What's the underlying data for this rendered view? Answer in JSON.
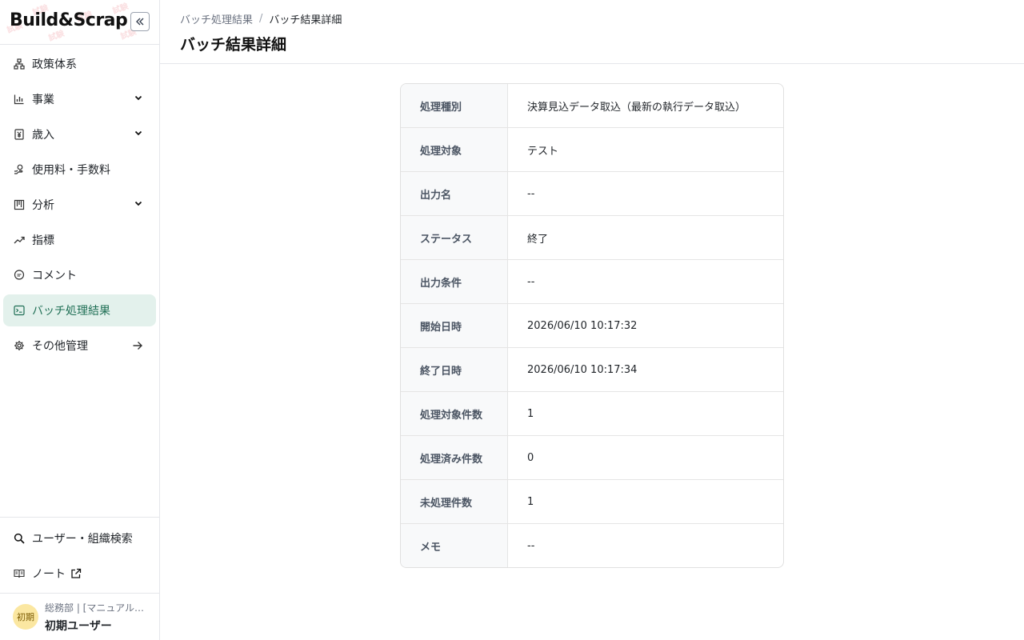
{
  "brand": {
    "logo_text": "Build&Scrap",
    "stamp_text": "試験"
  },
  "sidebar": {
    "items": [
      {
        "label": "政策体系",
        "icon": "hierarchy-icon",
        "has_chevron": false
      },
      {
        "label": "事業",
        "icon": "bar-chart-icon",
        "has_chevron": true
      },
      {
        "label": "歳入",
        "icon": "yen-box-icon",
        "has_chevron": true
      },
      {
        "label": "使用料・手数料",
        "icon": "coin-hand-icon",
        "has_chevron": false
      },
      {
        "label": "分析",
        "icon": "board-icon",
        "has_chevron": true
      },
      {
        "label": "指標",
        "icon": "trend-icon",
        "has_chevron": false
      },
      {
        "label": "コメント",
        "icon": "comment-icon",
        "has_chevron": false
      },
      {
        "label": "バッチ処理結果",
        "icon": "terminal-icon",
        "has_chevron": false,
        "active": true
      },
      {
        "label": "その他管理",
        "icon": "gear-icon",
        "has_arrow": true
      }
    ],
    "bottom": [
      {
        "label": "ユーザー・組織検索",
        "icon": "search-icon"
      },
      {
        "label": "ノート",
        "icon": "book-icon",
        "external": true
      }
    ],
    "user": {
      "avatar": "初期",
      "dept": "総務部 | [マニュアル…",
      "name": "初期ユーザー"
    }
  },
  "header": {
    "breadcrumb": {
      "parent": "バッチ処理結果",
      "separator": "/",
      "current": "バッチ結果詳細"
    },
    "title": "バッチ結果詳細"
  },
  "detail": {
    "rows": [
      {
        "label": "処理種別",
        "value": "決算見込データ取込（最新の執行データ取込）"
      },
      {
        "label": "処理対象",
        "value": "テスト"
      },
      {
        "label": "出力名",
        "value": "--"
      },
      {
        "label": "ステータス",
        "value": "終了"
      },
      {
        "label": "出力条件",
        "value": "--"
      },
      {
        "label": "開始日時",
        "value": "2026/06/10 10:17:32"
      },
      {
        "label": "終了日時",
        "value": "2026/06/10 10:17:34"
      },
      {
        "label": "処理対象件数",
        "value": "1"
      },
      {
        "label": "処理済み件数",
        "value": "0"
      },
      {
        "label": "未処理件数",
        "value": "1"
      },
      {
        "label": "メモ",
        "value": "--"
      }
    ]
  },
  "colors": {
    "active_bg": "#e3f1ec",
    "active_text": "#1f6f55",
    "avatar_bg": "#fbe7a1"
  }
}
